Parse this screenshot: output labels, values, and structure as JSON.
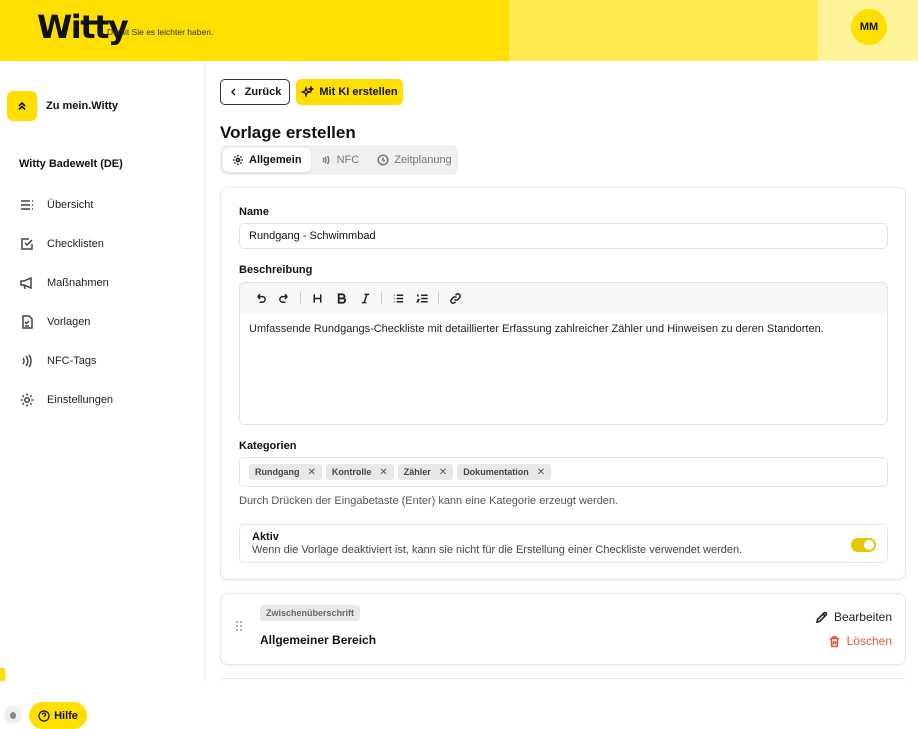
{
  "header": {
    "logo": "Witty",
    "tagline": "Damit Sie es leichter haben.",
    "avatar_initials": "MM"
  },
  "sidebar": {
    "back_label": "Zu mein.Witty",
    "org_name": "Witty Badewelt (DE)",
    "items": [
      {
        "label": "Übersicht",
        "icon": "list-icon"
      },
      {
        "label": "Checklisten",
        "icon": "checkbox-icon"
      },
      {
        "label": "Maßnahmen",
        "icon": "megaphone-icon"
      },
      {
        "label": "Vorlagen",
        "icon": "template-icon"
      },
      {
        "label": "NFC-Tags",
        "icon": "nfc-icon"
      },
      {
        "label": "Einstellungen",
        "icon": "gear-icon"
      }
    ],
    "help_label": "Hilfe"
  },
  "main": {
    "back_button": "Zurück",
    "ai_button": "Mit KI erstellen",
    "title": "Vorlage erstellen",
    "tabs": [
      {
        "label": "Allgemein",
        "active": true
      },
      {
        "label": "NFC",
        "active": false
      },
      {
        "label": "Zeitplanung",
        "active": false
      }
    ],
    "form": {
      "name_label": "Name",
      "name_value": "Rundgang - Schwimmbad",
      "description_label": "Beschreibung",
      "description_value": "Umfassende Rundgangs-Checkliste mit detaillierter Erfassung zahlreicher Zähler und Hinweisen zu deren Standorten.",
      "categories_label": "Kategorien",
      "categories": [
        "Rundgang",
        "Kontrolle",
        "Zähler",
        "Dokumentation"
      ],
      "categories_hint": "Durch Drücken der Eingabetaste (Enter) kann eine Kategorie erzeugt werden.",
      "active_label": "Aktiv",
      "active_description": "Wenn die Vorlage deaktiviert ist, kann sie nicht für die Erstellung einer Checkliste verwendet werden.",
      "active": true
    },
    "section": {
      "badge": "Zwischenüberschrift",
      "title": "Allgemeiner Bereich",
      "edit_label": "Bearbeiten",
      "delete_label": "Löschen"
    }
  },
  "colors": {
    "brand": "#ffdf00",
    "danger": "#e0563e"
  }
}
